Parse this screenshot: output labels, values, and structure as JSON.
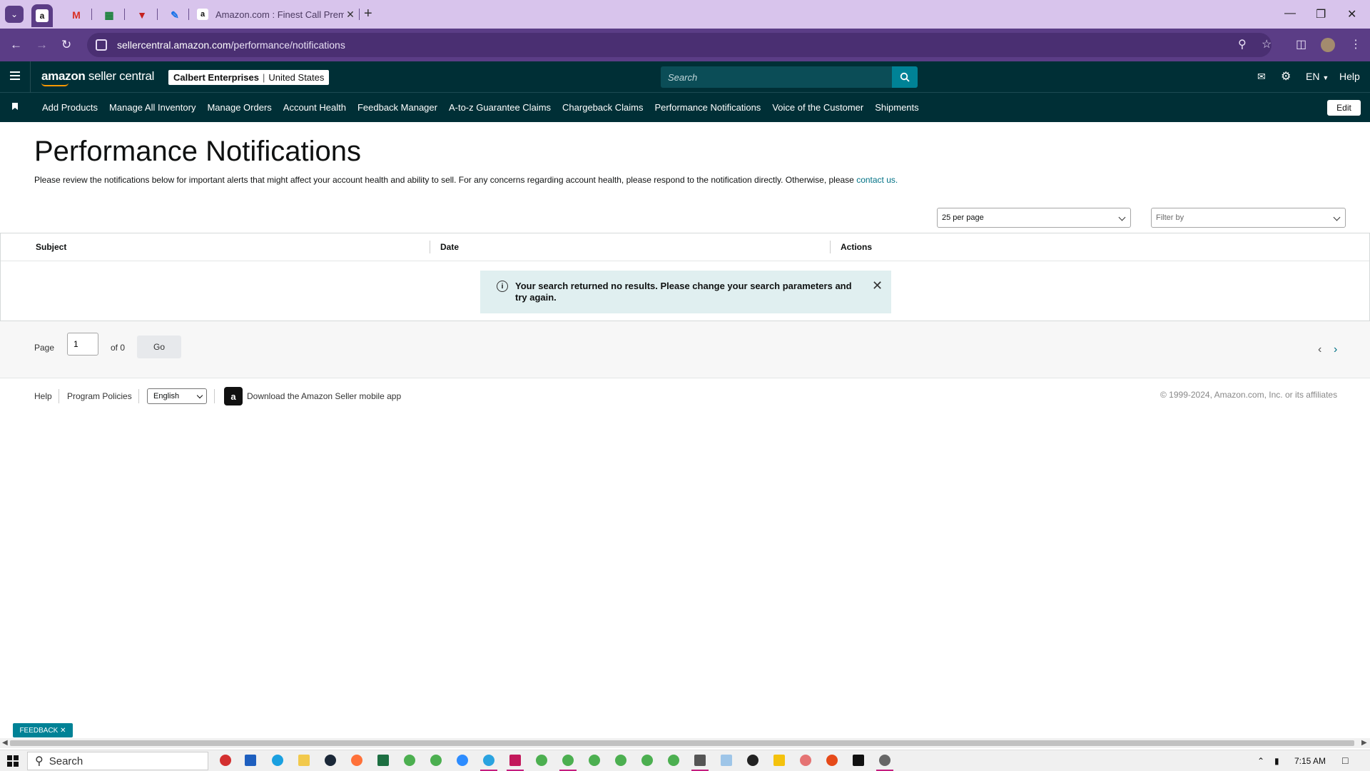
{
  "browser": {
    "tab_title": "Amazon.com : Finest Call Prem",
    "url_domain": "sellercentral.amazon.com",
    "url_path": "/performance/notifications"
  },
  "header": {
    "logo_bold": "amazon",
    "logo_rest": " seller central",
    "account_name": "Calbert Enterprises",
    "account_region": "United States",
    "search_placeholder": "Search",
    "language": "EN",
    "help": "Help"
  },
  "nav": {
    "items": [
      "Add Products",
      "Manage All Inventory",
      "Manage Orders",
      "Account Health",
      "Feedback Manager",
      "A-to-z Guarantee Claims",
      "Chargeback Claims",
      "Performance Notifications",
      "Voice of the Customer",
      "Shipments"
    ],
    "edit": "Edit"
  },
  "page": {
    "title": "Performance Notifications",
    "description": "Please review the notifications below for important alerts that might affect your account health and ability to sell. For any concerns regarding account health, please respond to the notification directly. Otherwise, please ",
    "contact_link": "contact us.",
    "per_page": "25 per page",
    "filter_placeholder": "Filter by"
  },
  "table": {
    "columns": [
      "Subject",
      "Date",
      "Actions"
    ],
    "alert_message": "Your search returned no results. Please change your search parameters and try again."
  },
  "pager": {
    "page_label": "Page",
    "page_value": "1",
    "of_label": "of 0",
    "go": "Go"
  },
  "footer": {
    "help": "Help",
    "policies": "Program Policies",
    "language": "English",
    "app_download": "Download the Amazon Seller mobile app",
    "copyright": "© 1999-2024, Amazon.com, Inc. or its affiliates"
  },
  "feedback": "FEEDBACK",
  "taskbar": {
    "search": "Search",
    "time": "7:15 AM"
  },
  "colors": {
    "header_bg": "#002f36",
    "accent": "#008296",
    "link": "#007185",
    "browser_frame": "#5b3d86"
  }
}
